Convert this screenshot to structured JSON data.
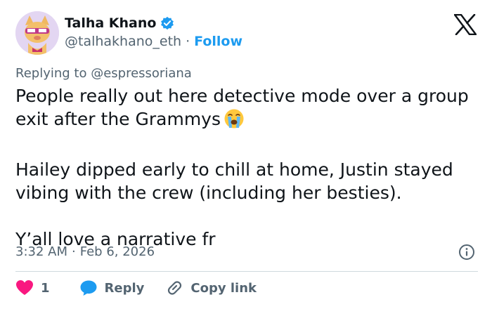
{
  "author": {
    "name": "Talha Khano",
    "handle": "@talhakhano_eth",
    "separator": "·",
    "follow_label": "Follow"
  },
  "tweet": {
    "replying_prefix": "Replying to ",
    "replying_to": "@espressoriana",
    "paragraph1": "People really out here detective mode over a group exit after the Grammys",
    "paragraph2": "Hailey dipped early to chill at home, Justin stayed vibing with the crew (including her besties).",
    "paragraph3": "Y’all love a narrative fr",
    "time": "3:32 AM",
    "separator": "·",
    "date": "Feb 6, 2026"
  },
  "actions": {
    "like_count": "1",
    "reply_label": "Reply",
    "copy_link_label": "Copy link"
  },
  "colors": {
    "accent": "#1d9bf0",
    "like": "#f91880",
    "muted": "#536471"
  },
  "icons": [
    "verified-badge-icon",
    "x-logo-icon",
    "crying-face-emoji",
    "info-icon",
    "heart-icon",
    "reply-bubble-icon",
    "link-icon"
  ]
}
